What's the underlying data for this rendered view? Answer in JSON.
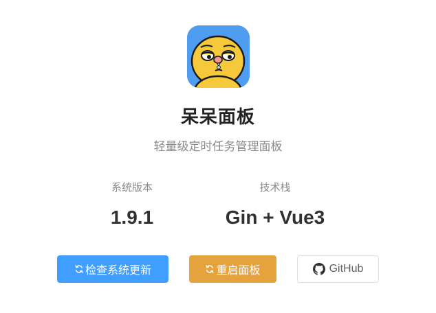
{
  "app": {
    "logo_icon": "yawning-duck-face-logo",
    "title": "呆呆面板",
    "subtitle": "轻量级定时任务管理面板"
  },
  "stats": {
    "version_label": "系统版本",
    "version_value": "1.9.1",
    "tech_label": "技术栈",
    "tech_value": "Gin + Vue3"
  },
  "actions": {
    "check_update_label": "检查系统更新",
    "check_update_icon": "refresh-icon",
    "restart_label": "重启面板",
    "restart_icon": "refresh-icon",
    "github_label": "GitHub",
    "github_icon": "github-icon"
  },
  "colors": {
    "primary": "#409eff",
    "warning": "#e6a23c",
    "title": "#222222",
    "muted": "#8a8a8a"
  }
}
